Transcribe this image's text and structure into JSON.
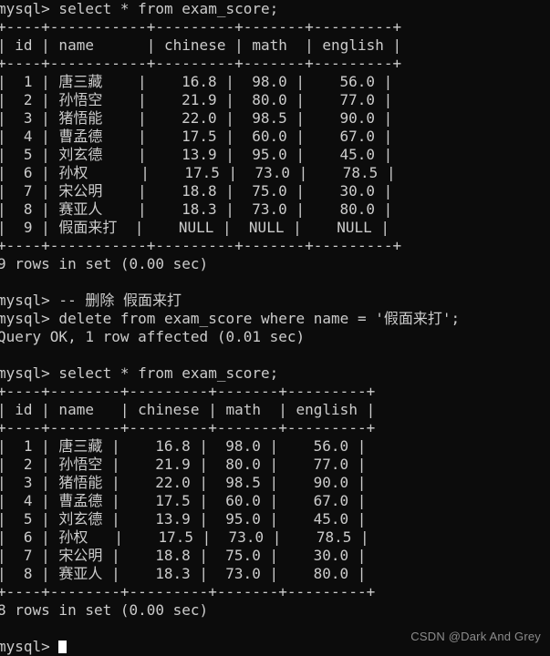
{
  "terminal": {
    "background_color": "#0c0c0c",
    "text_color": "#cccccc",
    "prompt": "mysql>",
    "cursor_color": "#ffffff"
  },
  "watermark": {
    "text": "CSDN @Dark And Grey",
    "color": "#8c8c8c"
  },
  "lines": [
    {
      "id": "cmd-select-1",
      "text": "mysql> select * from exam_score;"
    },
    {
      "id": "t1-border-top",
      "text": "+----+-----------+---------+-------+---------+"
    },
    {
      "id": "t1-header",
      "text": "| id | name      | chinese | math  | english |"
    },
    {
      "id": "t1-border-mid",
      "text": "+----+-----------+---------+-------+---------+"
    },
    {
      "id": "t1-row-1",
      "text": "|  1 | 唐三藏    |    16.8 |  98.0 |    56.0 |"
    },
    {
      "id": "t1-row-2",
      "text": "|  2 | 孙悟空    |    21.9 |  80.0 |    77.0 |"
    },
    {
      "id": "t1-row-3",
      "text": "|  3 | 猪悟能    |    22.0 |  98.5 |    90.0 |"
    },
    {
      "id": "t1-row-4",
      "text": "|  4 | 曹孟德    |    17.5 |  60.0 |    67.0 |"
    },
    {
      "id": "t1-row-5",
      "text": "|  5 | 刘玄德    |    13.9 |  95.0 |    45.0 |"
    },
    {
      "id": "t1-row-6",
      "text": "|  6 | 孙权      |    17.5 |  73.0 |    78.5 |"
    },
    {
      "id": "t1-row-7",
      "text": "|  7 | 宋公明    |    18.8 |  75.0 |    30.0 |"
    },
    {
      "id": "t1-row-8",
      "text": "|  8 | 赛亚人    |    18.3 |  73.0 |    80.0 |"
    },
    {
      "id": "t1-row-9",
      "text": "|  9 | 假面来打  |    NULL |  NULL |    NULL |"
    },
    {
      "id": "t1-border-bot",
      "text": "+----+-----------+---------+-------+---------+"
    },
    {
      "id": "t1-rowcount",
      "text": "9 rows in set (0.00 sec)"
    },
    {
      "id": "blank-1",
      "text": ""
    },
    {
      "id": "cmd-comment",
      "text": "mysql> -- 删除 假面来打"
    },
    {
      "id": "cmd-delete",
      "text": "mysql> delete from exam_score where name = '假面来打';"
    },
    {
      "id": "delete-result",
      "text": "Query OK, 1 row affected (0.01 sec)"
    },
    {
      "id": "blank-2",
      "text": ""
    },
    {
      "id": "cmd-select-2",
      "text": "mysql> select * from exam_score;"
    },
    {
      "id": "t2-border-top",
      "text": "+----+--------+---------+-------+---------+"
    },
    {
      "id": "t2-header",
      "text": "| id | name   | chinese | math  | english |"
    },
    {
      "id": "t2-border-mid",
      "text": "+----+--------+---------+-------+---------+"
    },
    {
      "id": "t2-row-1",
      "text": "|  1 | 唐三藏 |    16.8 |  98.0 |    56.0 |"
    },
    {
      "id": "t2-row-2",
      "text": "|  2 | 孙悟空 |    21.9 |  80.0 |    77.0 |"
    },
    {
      "id": "t2-row-3",
      "text": "|  3 | 猪悟能 |    22.0 |  98.5 |    90.0 |"
    },
    {
      "id": "t2-row-4",
      "text": "|  4 | 曹孟德 |    17.5 |  60.0 |    67.0 |"
    },
    {
      "id": "t2-row-5",
      "text": "|  5 | 刘玄德 |    13.9 |  95.0 |    45.0 |"
    },
    {
      "id": "t2-row-6",
      "text": "|  6 | 孙权   |    17.5 |  73.0 |    78.5 |"
    },
    {
      "id": "t2-row-7",
      "text": "|  7 | 宋公明 |    18.8 |  75.0 |    30.0 |"
    },
    {
      "id": "t2-row-8",
      "text": "|  8 | 赛亚人 |    18.3 |  73.0 |    80.0 |"
    },
    {
      "id": "t2-border-bot",
      "text": "+----+--------+---------+-------+---------+"
    },
    {
      "id": "t2-rowcount",
      "text": "8 rows in set (0.00 sec)"
    },
    {
      "id": "blank-3",
      "text": ""
    }
  ],
  "final_prompt": {
    "text": "mysql>"
  },
  "table_1": {
    "columns": [
      "id",
      "name",
      "chinese",
      "math",
      "english"
    ],
    "rows": [
      [
        "1",
        "唐三藏",
        "16.8",
        "98.0",
        "56.0"
      ],
      [
        "2",
        "孙悟空",
        "21.9",
        "80.0",
        "77.0"
      ],
      [
        "3",
        "猪悟能",
        "22.0",
        "98.5",
        "90.0"
      ],
      [
        "4",
        "曹孟德",
        "17.5",
        "60.0",
        "67.0"
      ],
      [
        "5",
        "刘玄德",
        "13.9",
        "95.0",
        "45.0"
      ],
      [
        "6",
        "孙权",
        "17.5",
        "73.0",
        "78.5"
      ],
      [
        "7",
        "宋公明",
        "18.8",
        "75.0",
        "30.0"
      ],
      [
        "8",
        "赛亚人",
        "18.3",
        "73.0",
        "80.0"
      ],
      [
        "9",
        "假面来打",
        "NULL",
        "NULL",
        "NULL"
      ]
    ],
    "row_count_text": "9 rows in set (0.00 sec)"
  },
  "table_2": {
    "columns": [
      "id",
      "name",
      "chinese",
      "math",
      "english"
    ],
    "rows": [
      [
        "1",
        "唐三藏",
        "16.8",
        "98.0",
        "56.0"
      ],
      [
        "2",
        "孙悟空",
        "21.9",
        "80.0",
        "77.0"
      ],
      [
        "3",
        "猪悟能",
        "22.0",
        "98.5",
        "90.0"
      ],
      [
        "4",
        "曹孟德",
        "17.5",
        "60.0",
        "67.0"
      ],
      [
        "5",
        "刘玄德",
        "13.9",
        "95.0",
        "45.0"
      ],
      [
        "6",
        "孙权",
        "17.5",
        "73.0",
        "78.5"
      ],
      [
        "7",
        "宋公明",
        "18.8",
        "75.0",
        "30.0"
      ],
      [
        "8",
        "赛亚人",
        "18.3",
        "73.0",
        "80.0"
      ]
    ],
    "row_count_text": "8 rows in set (0.00 sec)"
  }
}
